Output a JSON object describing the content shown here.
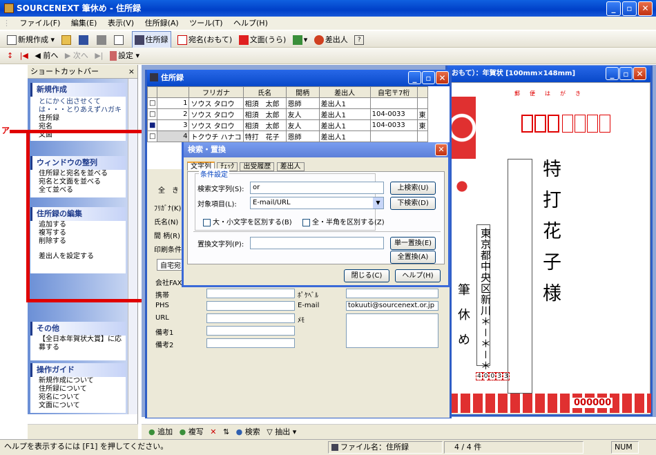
{
  "window": {
    "title": "SOURCENEXT 筆休め - 住所録"
  },
  "menu": [
    "ファイル(F)",
    "編集(E)",
    "表示(V)",
    "住所録(A)",
    "ツール(T)",
    "ヘルプ(H)"
  ],
  "toolbar1": [
    "新規作成",
    "住所録",
    "宛名(おもて)",
    "文面(うら)",
    "差出人"
  ],
  "toolbar2": {
    "first": "|◀",
    "prev": "◀ 前へ",
    "next": "▶ 次へ",
    "last": "▶|",
    "settings": "設定"
  },
  "annotation": "ア",
  "shortcut": {
    "title": "ショートカットバー",
    "close": "×",
    "sections": [
      {
        "title": "新規作成",
        "items": [
          "とにかく出させくては・・・とりあえずハガキ",
          "住所録",
          "宛名",
          "文面"
        ]
      },
      {
        "title": "ウィンドウの整列",
        "items": [
          "住所録と宛名を並べる",
          "宛名と文面を並べる",
          "全て並べる"
        ]
      },
      {
        "title": "住所録の編集",
        "items": [
          "追加する",
          "複写する",
          "削除する",
          "差出人を設定する"
        ]
      },
      {
        "title": "その他",
        "items": [
          "【全日本年賀状大賞】に応募する"
        ]
      },
      {
        "title": "操作ガイド",
        "items": [
          "新規作成について",
          "住所録について",
          "宛名について",
          "文面について"
        ]
      }
    ]
  },
  "address_window": {
    "title": "住所録",
    "headers": [
      "フリガナ",
      "氏名",
      "間柄",
      "差出人",
      "自宅〒7桁"
    ],
    "rows": [
      {
        "no": "1",
        "kana": "ソウス タロウ",
        "name": "相須　太郎",
        "rel": "恩師",
        "sender": "差出人1",
        "zip": "",
        "extra": ""
      },
      {
        "no": "2",
        "kana": "ソウス タロウ",
        "name": "相須　太郎",
        "rel": "友人",
        "sender": "差出人1",
        "zip": "104-0033",
        "extra": "東"
      },
      {
        "no": "3",
        "kana": "ソウス タロウ",
        "name": "相須　太郎",
        "rel": "友人",
        "sender": "差出人1",
        "zip": "104-0033",
        "extra": "東"
      },
      {
        "no": "4",
        "kana": "トクウチ ハナコ",
        "name": "特打　花子",
        "rel": "恩師",
        "sender": "差出人1",
        "zip": "",
        "extra": ""
      }
    ],
    "form": {
      "tabs": [
        "全",
        "き"
      ],
      "labels": [
        "ﾌﾘｶﾞﾅ(K)",
        "氏名(N)",
        "間 柄(R)",
        "印刷条件"
      ],
      "subtab": "自宅宛",
      "rows": [
        "会社FAX",
        "携帯",
        "PHS",
        "URL",
        "備考1",
        "備考2"
      ],
      "right_labels": [
        "ﾎﾟｹﾍﾞﾙ",
        "E-mail",
        "ﾒﾓ"
      ],
      "email": "tokuuti@sourcenext.or.jp"
    }
  },
  "card_window": {
    "title": "おもて）：年賀状 [100mm×148mm]",
    "postcard_label": "郵　便　は　が　き",
    "name": [
      "特",
      "打",
      "花",
      "子",
      "様"
    ],
    "address": "東京都中央区新川＊－＊－＊",
    "brush": [
      "筆",
      "休",
      "め"
    ],
    "zip": [
      "4",
      "0",
      "0",
      "3",
      "3"
    ],
    "lottery": "000000"
  },
  "dialog": {
    "title": "検索・置換",
    "tabs": [
      "文字列",
      "ﾁｪｯｸ",
      "出受履歴",
      "差出人"
    ],
    "group": "条件設定",
    "search_label": "検索文字列(S):",
    "search_value": "or",
    "target_label": "対象項目(L):",
    "target_value": "E-mail/URL",
    "case_label": "大・小文字を区別する(B)",
    "width_label": "全・半角を区別する(Z)",
    "replace_label": "置換文字列(P):",
    "replace_value": "",
    "btn_up": "上検索(U)",
    "btn_down": "下検索(D)",
    "btn_replace": "単一置換(E)",
    "btn_replace_all": "全置換(A)",
    "btn_close": "閉じる(C)",
    "btn_help": "ヘルプ(H)"
  },
  "bottom_toolbar": [
    "追加",
    "複写",
    "検索",
    "抽出"
  ],
  "status": {
    "help": "ヘルプを表示するには [F1] を押してください。",
    "file": "ファイル名：住所録",
    "count": "4 / 4 件",
    "num": "NUM"
  }
}
